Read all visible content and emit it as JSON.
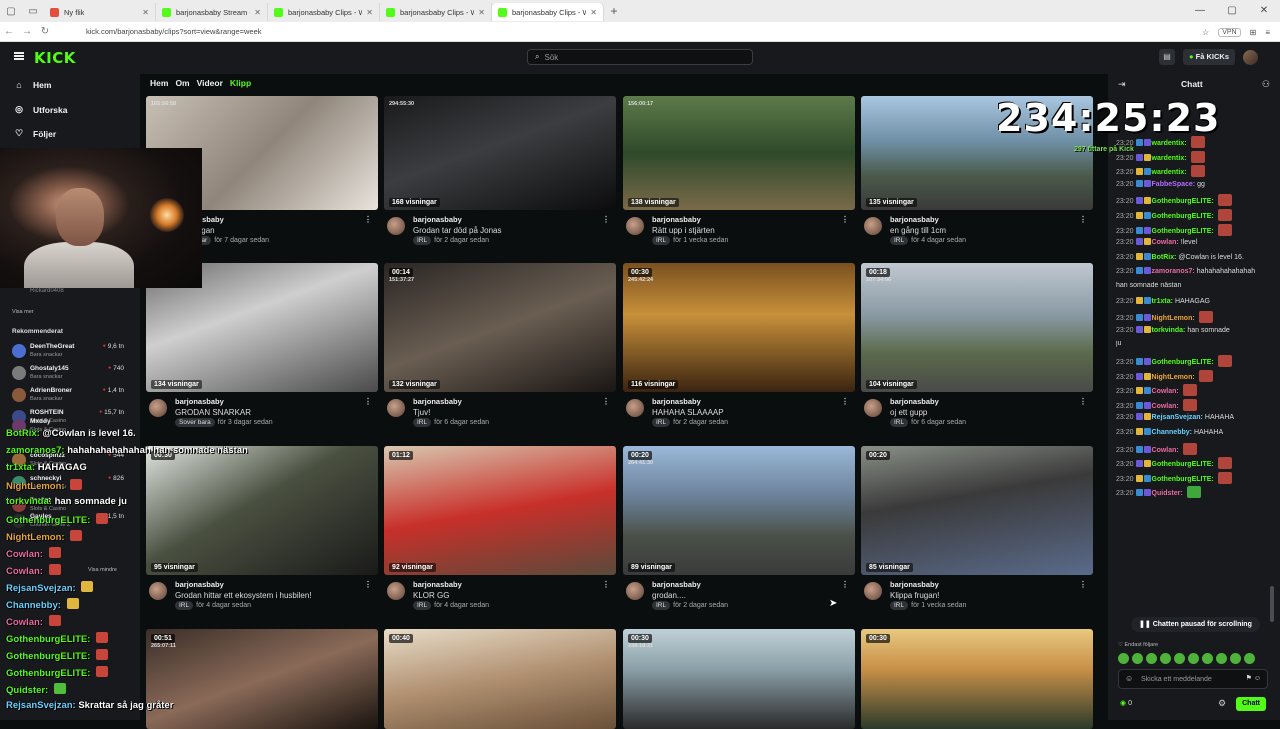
{
  "browser": {
    "tabs": [
      {
        "title": "Ny flik",
        "favicon_color": "#e34f3a"
      },
      {
        "title": "barjonasbaby Stream - Watch Live",
        "favicon_color": "#53fc18"
      },
      {
        "title": "barjonasbaby Clips - Watch Live",
        "favicon_color": "#53fc18"
      },
      {
        "title": "barjonasbaby Clips - Watch Live",
        "favicon_color": "#53fc18"
      },
      {
        "title": "barjonasbaby Clips - Watch Live",
        "favicon_color": "#53fc18"
      }
    ],
    "url": "kick.com/barjonasbaby/clips?sort=view&range=week",
    "vpn_label": "VPN"
  },
  "header": {
    "logo": "KICK",
    "search_placeholder": "Sök",
    "get_kicks_label": "Få KICKs"
  },
  "sidebar": {
    "nav": [
      {
        "label": "Hem",
        "icon": "home-icon"
      },
      {
        "label": "Utforska",
        "icon": "compass-icon"
      },
      {
        "label": "Följer",
        "icon": "heart-icon"
      }
    ],
    "viewer_name": "Rickard0408",
    "see_more": "Visa mer",
    "recommended_title": "Rekommenderat",
    "recommended": [
      {
        "name": "DeenTheGreat",
        "category": "Bara snackar",
        "viewers": "9,6 tn",
        "color": "#4a6fd0"
      },
      {
        "name": "Ghostaly145",
        "category": "Bara snackar",
        "viewers": "740",
        "color": "#7b7b7b"
      },
      {
        "name": "AdrienBroner",
        "category": "Bara snackar",
        "viewers": "1,4 tn",
        "color": "#8a5a3a"
      },
      {
        "name": "ROSHTEIN",
        "category": "Slots & Casino",
        "viewers": "15,7 tn",
        "color": "#3a4a8a"
      },
      {
        "name": "Mxddy",
        "category": "Slots & Casino",
        "viewers": "",
        "color": "#6a3a6a"
      },
      {
        "name": "cocospinzz",
        "category": "Slots & Casino",
        "viewers": "544",
        "color": "#9a6a3a"
      },
      {
        "name": "schneckyi",
        "category": "Slots & Casino",
        "viewers": "826",
        "color": "#3a8a6a"
      },
      {
        "name": "7sc3nt",
        "category": "Slots & Casino",
        "viewers": "",
        "color": "#8a3a3a"
      },
      {
        "name": "Gaules",
        "category": "Counter-Strike 2",
        "viewers": "1,5 tn",
        "color": "#2a2a2a"
      }
    ],
    "show_less": "Visa mindre"
  },
  "overlay_chat": [
    {
      "user": "BotRix:",
      "text": "@Cowlan is level 16.",
      "color": "#53fc18",
      "emote": ""
    },
    {
      "user": "zamoranos7:",
      "text": "hahahahahahahah han somnade nästan",
      "color": "#53fc18",
      "emote": ""
    },
    {
      "user": "tr1xta:",
      "text": "HAHAGAG",
      "color": "#53fc18",
      "emote": ""
    },
    {
      "user": "NightLemon:",
      "text": "",
      "color": "#e9a63a",
      "emote": "red"
    },
    {
      "user": "torkvinda:",
      "text": "han somnade ju",
      "color": "#53fc18",
      "emote": ""
    },
    {
      "user": "GothenburgELITE:",
      "text": "",
      "color": "#53fc18",
      "emote": "red"
    },
    {
      "user": "NightLemon:",
      "text": "",
      "color": "#e9a63a",
      "emote": "red"
    },
    {
      "user": "Cowlan:",
      "text": "",
      "color": "#e96ca0",
      "emote": "red"
    },
    {
      "user": "Cowlan:",
      "text": "",
      "color": "#e96ca0",
      "emote": "red"
    },
    {
      "user": "RejsanSvejzan:",
      "text": "",
      "color": "#6ad0ff",
      "emote": "yellow"
    },
    {
      "user": "Channebby:",
      "text": "",
      "color": "#6ad0ff",
      "emote": "yellow"
    },
    {
      "user": "Cowlan:",
      "text": "",
      "color": "#e96ca0",
      "emote": "red"
    },
    {
      "user": "GothenburgELITE:",
      "text": "",
      "color": "#53fc18",
      "emote": "red"
    },
    {
      "user": "GothenburgELITE:",
      "text": "",
      "color": "#53fc18",
      "emote": "red"
    },
    {
      "user": "GothenburgELITE:",
      "text": "",
      "color": "#53fc18",
      "emote": "red"
    },
    {
      "user": "Quidster:",
      "text": "",
      "color": "#53fc18",
      "emote": "green"
    },
    {
      "user": "RejsanSvejzan:",
      "text": "Skrattar så jag gråter",
      "color": "#6ad0ff",
      "emote": ""
    }
  ],
  "main": {
    "tabs": [
      {
        "label": "Hem",
        "active": false
      },
      {
        "label": "Om",
        "active": false
      },
      {
        "label": "Videor",
        "active": false
      },
      {
        "label": "Klipp",
        "active": true
      }
    ],
    "clips": [
      {
        "duration": "",
        "stamp": "165:56:58",
        "views": "",
        "user": "barjonasbaby",
        "title": "...s bengan",
        "tag": "...snackar",
        "age": "för 7 dagar sedan"
      },
      {
        "duration": "",
        "stamp": "294:55:30",
        "views": "168 visningar",
        "user": "barjonasbaby",
        "title": "Grodan tar död på Jonas",
        "tag": "IRL",
        "age": "för 2 dagar sedan"
      },
      {
        "duration": "",
        "stamp": "156:00:17",
        "views": "138 visningar",
        "user": "barjonasbaby",
        "title": "Rätt upp i stjärten",
        "tag": "IRL",
        "age": "för 1 vecka sedan"
      },
      {
        "duration": "",
        "stamp": "",
        "views": "135 visningar",
        "user": "barjonasbaby",
        "title": "en gång till 1cm",
        "tag": "IRL",
        "age": "för 4 dagar sedan"
      },
      {
        "duration": "",
        "stamp": "",
        "views": "134 visningar",
        "user": "barjonasbaby",
        "title": "GRODAN SNARKAR",
        "tag": "Sover bara",
        "age": "för 3 dagar sedan"
      },
      {
        "duration": "00:14",
        "stamp": "151:37:27",
        "views": "132 visningar",
        "user": "barjonasbaby",
        "title": "Tjuv!",
        "tag": "IRL",
        "age": "för 6 dagar sedan"
      },
      {
        "duration": "00:30",
        "stamp": "245:42:24",
        "views": "116 visningar",
        "user": "barjonasbaby",
        "title": "HAHAHA SLAAAAP",
        "tag": "IRL",
        "age": "för 2 dagar sedan"
      },
      {
        "duration": "00:18",
        "stamp": "107:34:06",
        "views": "104 visningar",
        "user": "barjonasbaby",
        "title": "oj ett gupp",
        "tag": "IRL",
        "age": "för 6 dagar sedan"
      },
      {
        "duration": "00:30",
        "stamp": "",
        "views": "95 visningar",
        "user": "barjonasbaby",
        "title": "Grodan hittar ett ekosystem i husbilen!",
        "tag": "IRL",
        "age": "för 4 dagar sedan"
      },
      {
        "duration": "01:12",
        "stamp": "",
        "views": "92 visningar",
        "user": "barjonasbaby",
        "title": "KLOR GG",
        "tag": "IRL",
        "age": "för 4 dagar sedan"
      },
      {
        "duration": "00:20",
        "stamp": "264:41:30",
        "views": "89 visningar",
        "user": "barjonasbaby",
        "title": "grodan....",
        "tag": "IRL",
        "age": "för 2 dagar sedan"
      },
      {
        "duration": "00:20",
        "stamp": "",
        "views": "85 visningar",
        "user": "barjonasbaby",
        "title": "Klippa frugan!",
        "tag": "IRL",
        "age": "för 1 vecka sedan"
      },
      {
        "duration": "00:51",
        "stamp": "265:07:11",
        "views": "",
        "user": "",
        "title": "",
        "tag": "",
        "age": ""
      },
      {
        "duration": "00:40",
        "stamp": "",
        "views": "",
        "user": "",
        "title": "",
        "tag": "",
        "age": ""
      },
      {
        "duration": "00:30",
        "stamp": "238:18:21",
        "views": "",
        "user": "",
        "title": "",
        "tag": "",
        "age": ""
      },
      {
        "duration": "00:30",
        "stamp": "",
        "views": "",
        "user": "",
        "title": "",
        "tag": "",
        "age": ""
      }
    ]
  },
  "stream_overlay": {
    "timer": "234:25:23",
    "subtext": "297 tittare på Kick"
  },
  "chat": {
    "title": "Chatt",
    "pinned": "Quidster",
    "lines": [
      {
        "time": "23:20",
        "user": "wardentix:",
        "text": "",
        "color": "#53fc18",
        "emote": "red"
      },
      {
        "time": "23:20",
        "user": "wardentix:",
        "text": "",
        "color": "#53fc18",
        "emote": "red"
      },
      {
        "time": "23:20",
        "user": "wardentix:",
        "text": "",
        "color": "#53fc18",
        "emote": "red"
      },
      {
        "time": "23:20",
        "user": "FabbeSpace:",
        "text": "gg",
        "color": "#b56bff",
        "emote": ""
      },
      {
        "time": "23:20",
        "user": "GothenburgELITE:",
        "text": "",
        "color": "#53fc18",
        "emote": "red"
      },
      {
        "time": "23:20",
        "user": "GothenburgELITE:",
        "text": "",
        "color": "#53fc18",
        "emote": "red"
      },
      {
        "time": "23:20",
        "user": "GothenburgELITE:",
        "text": "",
        "color": "#53fc18",
        "emote": "red"
      },
      {
        "time": "23:20",
        "user": "Cowlan:",
        "text": "!level",
        "color": "#e96ca0",
        "emote": ""
      },
      {
        "time": "23:20",
        "user": "BotRix:",
        "text": "@Cowlan is level 16.",
        "color": "#53fc18",
        "emote": ""
      },
      {
        "time": "23:20",
        "user": "zamoranos7:",
        "text": "hahahahahahahah",
        "color": "#e96ca0",
        "emote": ""
      },
      {
        "time": "",
        "user": "",
        "text": "han somnade nästan",
        "color": "#dddddd",
        "emote": ""
      },
      {
        "time": "23:20",
        "user": "tr1xta:",
        "text": "HAHAGAG",
        "color": "#53fc18",
        "emote": ""
      },
      {
        "time": "23:20",
        "user": "NightLemon:",
        "text": "",
        "color": "#e9a63a",
        "emote": "red"
      },
      {
        "time": "23:20",
        "user": "torkvinda:",
        "text": "han somnade",
        "color": "#53fc18",
        "emote": ""
      },
      {
        "time": "",
        "user": "",
        "text": "ju",
        "color": "#dddddd",
        "emote": ""
      },
      {
        "time": "23:20",
        "user": "GothenburgELITE:",
        "text": "",
        "color": "#53fc18",
        "emote": "red"
      },
      {
        "time": "23:20",
        "user": "NightLemon:",
        "text": "",
        "color": "#e9a63a",
        "emote": "red"
      },
      {
        "time": "23:20",
        "user": "Cowlan:",
        "text": "",
        "color": "#e96ca0",
        "emote": "red"
      },
      {
        "time": "23:20",
        "user": "Cowlan:",
        "text": "",
        "color": "#e96ca0",
        "emote": "red"
      },
      {
        "time": "23:20",
        "user": "RejsanSvejzan:",
        "text": "HAHAHA",
        "color": "#6ad0ff",
        "emote": ""
      },
      {
        "time": "23:20",
        "user": "Channebby:",
        "text": "HAHAHA",
        "color": "#6ad0ff",
        "emote": ""
      },
      {
        "time": "23:20",
        "user": "Cowlan:",
        "text": "",
        "color": "#e96ca0",
        "emote": "red"
      },
      {
        "time": "23:20",
        "user": "GothenburgELITE:",
        "text": "",
        "color": "#53fc18",
        "emote": "red"
      },
      {
        "time": "23:20",
        "user": "GothenburgELITE:",
        "text": "",
        "color": "#53fc18",
        "emote": "red"
      },
      {
        "time": "23:20",
        "user": "Quidster:",
        "text": "",
        "color": "#e96ca0",
        "emote": "green"
      }
    ],
    "paused_label": "Chatten pausad för scrollning",
    "followers_only": "Endast följare",
    "input_placeholder": "Skicka ett meddelande",
    "points": "0",
    "send_label": "Chatt"
  }
}
